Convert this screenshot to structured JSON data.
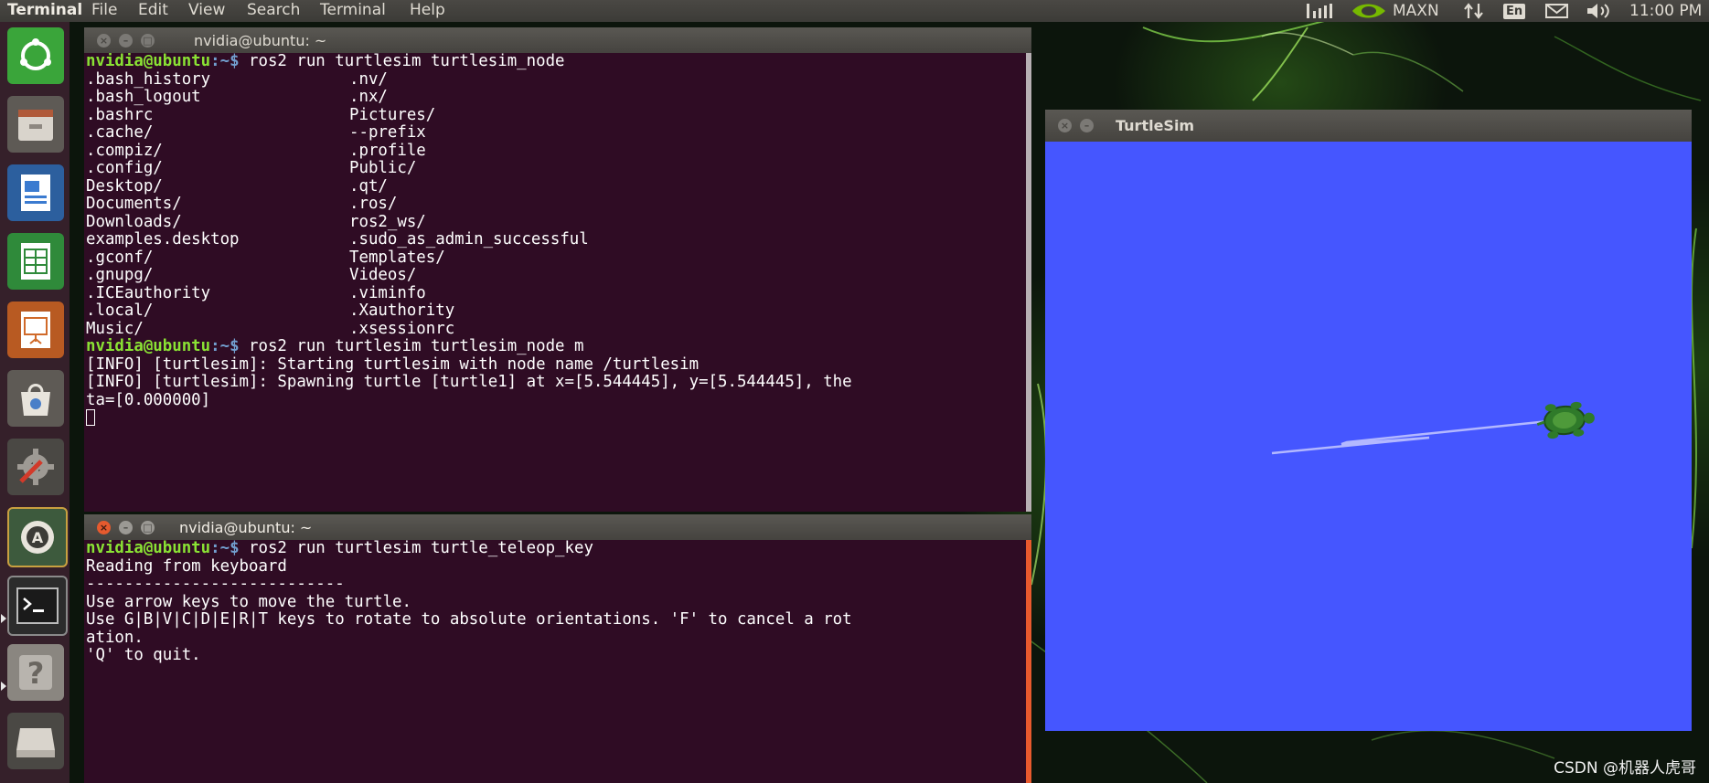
{
  "top_panel": {
    "app_name": "Terminal",
    "menu": [
      "File",
      "Edit",
      "View",
      "Search",
      "Terminal",
      "Help"
    ],
    "power_mode": "MAXN",
    "keyboard_layout": "En",
    "clock": "11:00 PM"
  },
  "launcher": {
    "items": [
      "ubuntu-dash-icon",
      "files-icon",
      "writer-icon",
      "calc-icon",
      "impress-icon",
      "software-center-icon",
      "system-settings-icon",
      "software-updater-icon",
      "terminal-icon",
      "help-icon",
      "drive-icon"
    ]
  },
  "terminal_top": {
    "title": "nvidia@ubuntu: ~",
    "prompt_user": "nvidia@ubuntu",
    "prompt_path": ":~$",
    "command1": " ros2 run turtlesim turtlesim_node",
    "ls_col1": [
      ".bash_history",
      ".bash_logout",
      ".bashrc",
      ".cache/",
      ".compiz/",
      ".config/",
      "Desktop/",
      "Documents/",
      "Downloads/",
      "examples.desktop",
      ".gconf/",
      ".gnupg/",
      ".ICEauthority",
      ".local/",
      "Music/"
    ],
    "ls_col2": [
      ".nv/",
      ".nx/",
      "Pictures/",
      "--prefix",
      ".profile",
      "Public/",
      ".qt/",
      ".ros/",
      "ros2_ws/",
      ".sudo_as_admin_successful",
      "Templates/",
      "Videos/",
      ".viminfo",
      ".Xauthority",
      ".xsessionrc"
    ],
    "command2": " ros2 run turtlesim turtlesim_node m",
    "log1": "[INFO] [turtlesim]: Starting turtlesim with node name /turtlesim",
    "log2a": "[INFO] [turtlesim]: Spawning turtle [turtle1] at x=[5.544445], y=[5.544445], the",
    "log2b": "ta=[0.000000]"
  },
  "terminal_bottom": {
    "title": "nvidia@ubuntu: ~",
    "prompt_user": "nvidia@ubuntu",
    "prompt_path": ":~$",
    "command": " ros2 run turtlesim turtle_teleop_key",
    "lines": [
      "Reading from keyboard",
      "---------------------------",
      "Use arrow keys to move the turtle.",
      "Use G|B|V|C|D|E|R|T keys to rotate to absolute orientations. 'F' to cancel a rot",
      "ation.",
      "'Q' to quit."
    ]
  },
  "turtlesim": {
    "title": "TurtleSim",
    "background_color": "#4556ff",
    "trail_color": "#b3b8ff"
  },
  "watermark": "CSDN @机器人虎哥"
}
